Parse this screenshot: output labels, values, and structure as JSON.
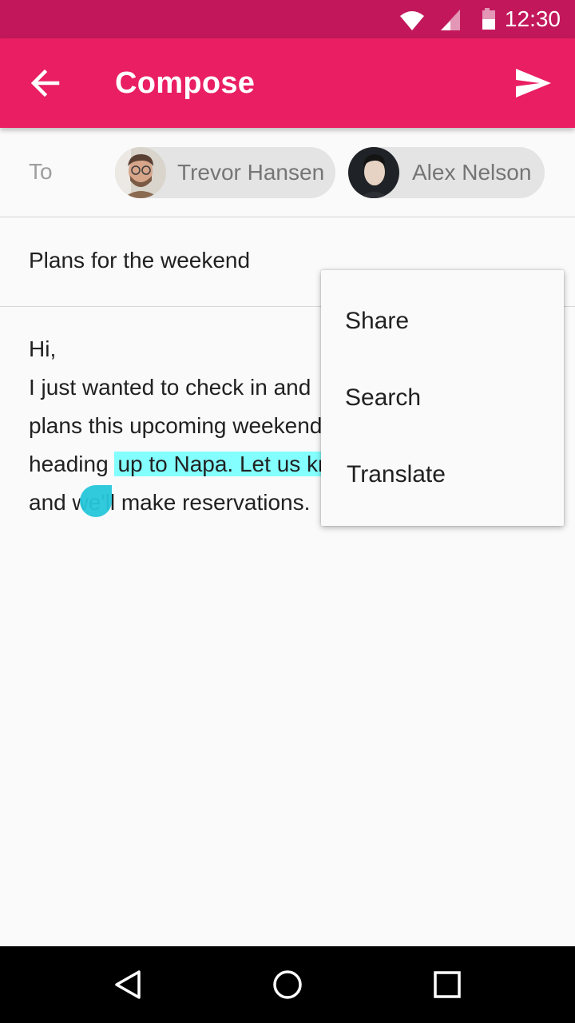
{
  "status_bar": {
    "time": "12:30",
    "background": "#c2185b"
  },
  "app_bar": {
    "title": "Compose",
    "background": "#e91e63",
    "icons": [
      "arrow-back-icon",
      "send-icon"
    ]
  },
  "recipients": {
    "label": "To",
    "chips": [
      {
        "name": "Trevor Hansen"
      },
      {
        "name": "Alex Nelson"
      }
    ]
  },
  "subject": "Plans for the weekend",
  "body": {
    "line1": "Hi,",
    "line2": "I just wanted to check in and",
    "line3": "plans this upcoming weekend",
    "line4_before": "heading ",
    "line4_selected": "up to Napa. Let us kn",
    "line5": "and we'll make reservations.",
    "selection_color": "#84ffff"
  },
  "context_menu": {
    "items": [
      "Share",
      "Search",
      "Translate"
    ]
  },
  "nav_bar": {
    "icons": [
      "nav-back-icon",
      "nav-home-icon",
      "nav-recents-icon"
    ]
  }
}
